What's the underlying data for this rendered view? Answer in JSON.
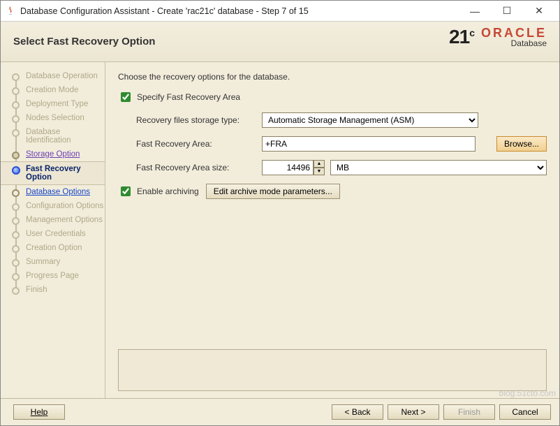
{
  "window": {
    "title": "Database Configuration Assistant - Create 'rac21c' database - Step 7 of 15"
  },
  "header": {
    "page_title": "Select Fast Recovery Option",
    "brand_version": "21",
    "brand_sup": "c",
    "brand_name": "ORACLE",
    "brand_sub": "Database"
  },
  "sidebar": {
    "steps": [
      {
        "label": "Database Operation",
        "state": "dim"
      },
      {
        "label": "Creation Mode",
        "state": "dim"
      },
      {
        "label": "Deployment Type",
        "state": "dim"
      },
      {
        "label": "Nodes Selection",
        "state": "dim"
      },
      {
        "label": "Database Identification",
        "state": "dim"
      },
      {
        "label": "Storage Option",
        "state": "visited"
      },
      {
        "label": "Fast Recovery Option",
        "state": "current"
      },
      {
        "label": "Database Options",
        "state": "next"
      },
      {
        "label": "Configuration Options",
        "state": "dim"
      },
      {
        "label": "Management Options",
        "state": "dim"
      },
      {
        "label": "User Credentials",
        "state": "dim"
      },
      {
        "label": "Creation Option",
        "state": "dim"
      },
      {
        "label": "Summary",
        "state": "dim"
      },
      {
        "label": "Progress Page",
        "state": "dim"
      },
      {
        "label": "Finish",
        "state": "dim"
      }
    ]
  },
  "content": {
    "instruction": "Choose the recovery options for the database.",
    "specify_fra_label": "Specify Fast Recovery Area",
    "storage_type_label": "Recovery files storage type:",
    "storage_type_value": "Automatic Storage Management (ASM)",
    "fra_label": "Fast Recovery Area:",
    "fra_value": "+FRA",
    "browse_label": "Browse...",
    "fra_size_label": "Fast Recovery Area size:",
    "fra_size_value": "14496",
    "fra_size_unit": "MB",
    "enable_archiving_label": "Enable archiving",
    "edit_archive_label": "Edit archive mode parameters..."
  },
  "footer": {
    "help": "Help",
    "back": "< Back",
    "next": "Next >",
    "finish": "Finish",
    "cancel": "Cancel"
  },
  "watermark": "blog.51cto.com"
}
